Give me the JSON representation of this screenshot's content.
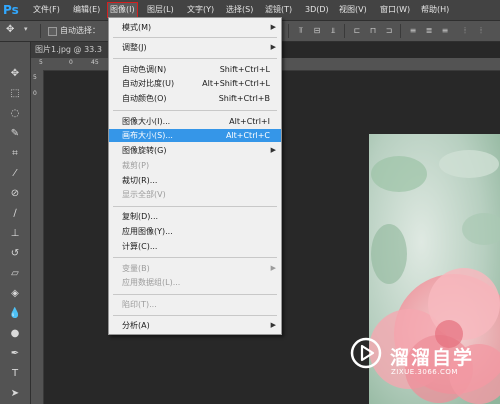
{
  "app": {
    "logo": "Ps"
  },
  "menubar": {
    "items": [
      "文件(F)",
      "编辑(E)",
      "图像(I)",
      "图层(L)",
      "文字(Y)",
      "选择(S)",
      "滤镜(T)",
      "3D(D)",
      "视图(V)",
      "窗口(W)",
      "帮助(H)"
    ]
  },
  "optionsbar": {
    "auto_select_label": "自动选择："
  },
  "document": {
    "tab_label": "图片1.jpg @ 33.3"
  },
  "rulers": {
    "top": [
      "5",
      "0",
      "45"
    ],
    "left": [
      "5",
      "0"
    ]
  },
  "image_menu": {
    "items": [
      {
        "label": "模式(M)",
        "shortcut": "",
        "submenu": true,
        "disabled": false
      },
      {
        "label": "调整(J)",
        "shortcut": "",
        "submenu": true,
        "disabled": false
      },
      {
        "label": "自动色调(N)",
        "shortcut": "Shift+Ctrl+L",
        "submenu": false,
        "disabled": false
      },
      {
        "label": "自动对比度(U)",
        "shortcut": "Alt+Shift+Ctrl+L",
        "submenu": false,
        "disabled": false
      },
      {
        "label": "自动颜色(O)",
        "shortcut": "Shift+Ctrl+B",
        "submenu": false,
        "disabled": false
      },
      {
        "label": "图像大小(I)...",
        "shortcut": "Alt+Ctrl+I",
        "submenu": false,
        "disabled": false
      },
      {
        "label": "画布大小(S)...",
        "shortcut": "Alt+Ctrl+C",
        "submenu": false,
        "disabled": false,
        "selected": true
      },
      {
        "label": "图像旋转(G)",
        "shortcut": "",
        "submenu": true,
        "disabled": false
      },
      {
        "label": "裁剪(P)",
        "shortcut": "",
        "submenu": false,
        "disabled": true
      },
      {
        "label": "裁切(R)...",
        "shortcut": "",
        "submenu": false,
        "disabled": false
      },
      {
        "label": "显示全部(V)",
        "shortcut": "",
        "submenu": false,
        "disabled": true
      },
      {
        "label": "复制(D)...",
        "shortcut": "",
        "submenu": false,
        "disabled": false
      },
      {
        "label": "应用图像(Y)...",
        "shortcut": "",
        "submenu": false,
        "disabled": false
      },
      {
        "label": "计算(C)...",
        "shortcut": "",
        "submenu": false,
        "disabled": false
      },
      {
        "label": "变量(B)",
        "shortcut": "",
        "submenu": true,
        "disabled": true
      },
      {
        "label": "应用数据组(L)...",
        "shortcut": "",
        "submenu": false,
        "disabled": true
      },
      {
        "label": "陷印(T)...",
        "shortcut": "",
        "submenu": false,
        "disabled": true
      },
      {
        "label": "分析(A)",
        "shortcut": "",
        "submenu": true,
        "disabled": false
      }
    ]
  },
  "watermark": {
    "name": "溜溜自学",
    "url": "ZIXUE.3066.COM"
  },
  "colors": {
    "menubar_bg": "#434343",
    "panel_bg": "#535353",
    "canvas_bg": "#282828",
    "menu_bg": "#f0f0f0",
    "menu_highlight": "#3596e8",
    "ps_blue": "#31a8ff",
    "active_menu_border": "#d42020"
  }
}
